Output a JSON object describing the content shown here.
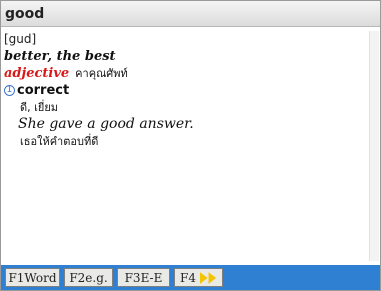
{
  "header": {
    "title": "good"
  },
  "entry": {
    "pronunciation": "[gud]",
    "forms": "better, the best",
    "pos": "adjective",
    "pos_translation": "คาคุณศัพท์",
    "senses": [
      {
        "number": "1",
        "word": "correct",
        "translation": "ดี, เยี่ยม",
        "example": "She gave a good answer.",
        "example_translation": "เธอให้คำตอบที่ดี"
      }
    ]
  },
  "function_keys": [
    {
      "label": "F1Word"
    },
    {
      "label": "F2e.g."
    },
    {
      "label": "F3E-E"
    },
    {
      "label": "F4",
      "icon": "double-arrow-right-icon"
    }
  ],
  "colors": {
    "pos_red": "#d81818",
    "sense_blue": "#3e78c8",
    "function_bar_blue": "#2f7fd2",
    "arrow_yellow": "#f5c400"
  }
}
